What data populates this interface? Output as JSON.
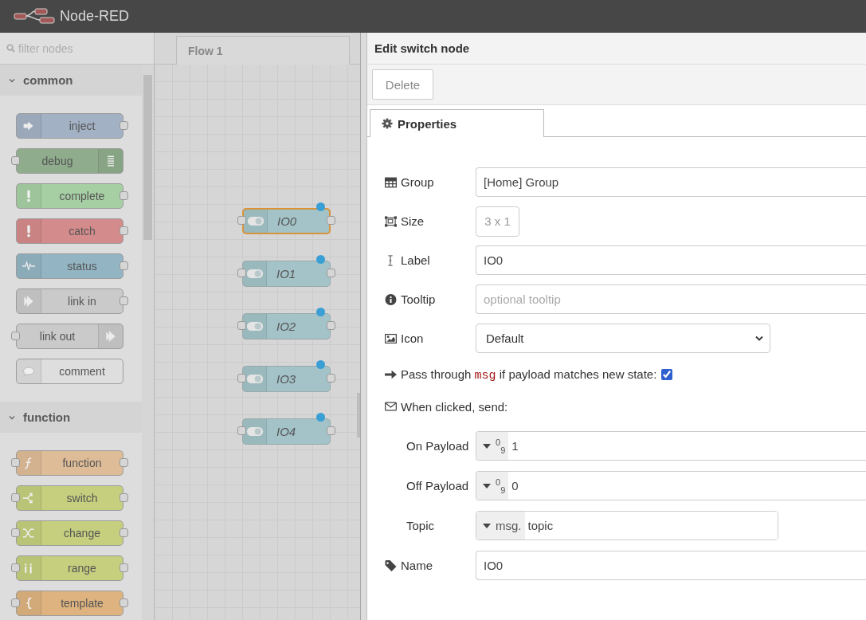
{
  "header": {
    "title": "Node-RED"
  },
  "palette": {
    "filter_placeholder": "filter nodes",
    "categories": [
      {
        "name": "common",
        "expanded": true,
        "nodes": [
          {
            "label": "inject",
            "kind": "inject",
            "color": "#a3b1c5"
          },
          {
            "label": "debug",
            "kind": "debug",
            "color": "#8fad8c"
          },
          {
            "label": "complete",
            "kind": "complete",
            "color": "#a6cfa4"
          },
          {
            "label": "catch",
            "kind": "catch",
            "color": "#d48b8b"
          },
          {
            "label": "status",
            "kind": "status",
            "color": "#93b5c3"
          },
          {
            "label": "link in",
            "kind": "linkin",
            "color": "#cacaca"
          },
          {
            "label": "link out",
            "kind": "linkout",
            "color": "#cacaca"
          },
          {
            "label": "comment",
            "kind": "comment",
            "color": "#dedede"
          }
        ]
      },
      {
        "name": "function",
        "expanded": true,
        "nodes": [
          {
            "label": "function",
            "kind": "function",
            "color": "#dfbc98"
          },
          {
            "label": "switch",
            "kind": "switch",
            "color": "#c5cf7e"
          },
          {
            "label": "change",
            "kind": "change",
            "color": "#c5cf7e"
          },
          {
            "label": "range",
            "kind": "range",
            "color": "#c5cf7e"
          },
          {
            "label": "template",
            "kind": "template",
            "color": "#deb37f"
          }
        ]
      }
    ]
  },
  "workspace": {
    "tabs": [
      {
        "label": "Flow 1",
        "selected": true
      }
    ],
    "nodes": [
      {
        "label": "IO0",
        "selected": true,
        "changed": true
      },
      {
        "label": "IO1",
        "selected": false,
        "changed": true
      },
      {
        "label": "IO2",
        "selected": false,
        "changed": true
      },
      {
        "label": "IO3",
        "selected": false,
        "changed": true
      },
      {
        "label": "IO4",
        "selected": false,
        "changed": true
      }
    ]
  },
  "editor": {
    "title": "Edit switch node",
    "buttons": [
      "Delete"
    ],
    "tabs": [
      {
        "label": "Properties",
        "selected": true
      }
    ],
    "rows": [
      {
        "kind": "text",
        "label": "Group",
        "value": "[Home] Group"
      },
      {
        "kind": "size",
        "label": "Size",
        "value": "3 x 1"
      },
      {
        "kind": "text",
        "label": "Label",
        "value": "IO0"
      },
      {
        "kind": "text",
        "label": "Tooltip",
        "placeholder": "optional tooltip"
      },
      {
        "kind": "select",
        "label": "Icon",
        "value": "Default"
      },
      {
        "kind": "checkbox",
        "label": "Pass through",
        "code": "msg",
        "label_after": "if payload matches new state:",
        "checked": true
      },
      {
        "kind": "section",
        "label": "When clicked, send:",
        "children": [
          {
            "kind": "typed",
            "label": "On Payload",
            "type_symbol": "$^{0}$$_{9}$",
            "value": "1"
          },
          {
            "kind": "typed",
            "label": "Off Payload",
            "type_symbol": "$^{0}$$_{9}$",
            "value": "0"
          },
          {
            "kind": "typed",
            "label": "Topic",
            "type_symbol": "msg.",
            "value": "topic"
          }
        ]
      },
      {
        "kind": "text",
        "label": "Name",
        "value": "IO0"
      }
    ]
  }
}
